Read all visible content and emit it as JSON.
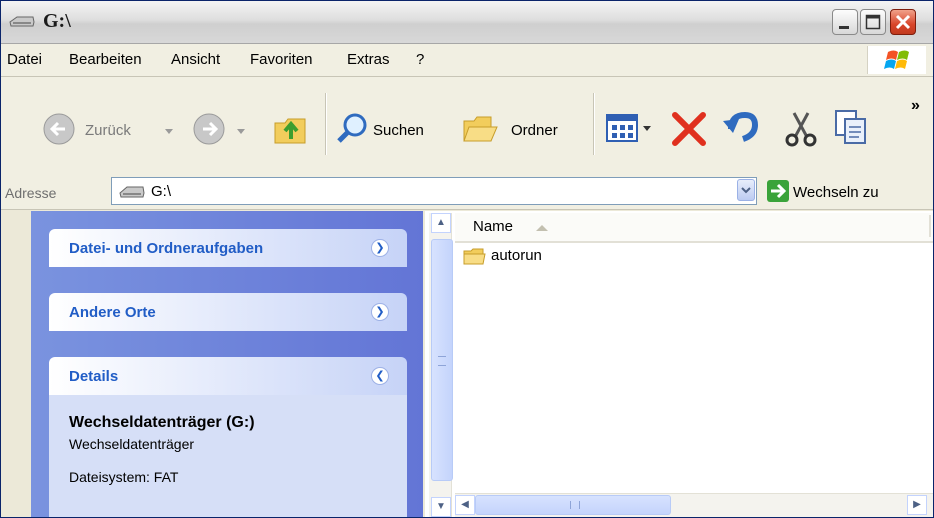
{
  "window": {
    "title": "G:\\"
  },
  "menubar": {
    "items": [
      {
        "label": "Datei"
      },
      {
        "label": "Bearbeiten"
      },
      {
        "label": "Ansicht"
      },
      {
        "label": "Favoriten"
      },
      {
        "label": "Extras"
      },
      {
        "label": "?"
      }
    ]
  },
  "toolbar": {
    "back_label": "Zurück",
    "search_label": "Suchen",
    "folders_label": "Ordner",
    "overflow": "»",
    "icons": [
      "back-icon",
      "forward-icon",
      "up-folder-icon",
      "search-icon",
      "folders-icon",
      "views-icon",
      "delete-icon",
      "undo-icon",
      "cut-icon",
      "copy-icon"
    ]
  },
  "address": {
    "label": "Adresse",
    "value": "G:\\",
    "go_label": "Wechseln zu"
  },
  "taskpane": {
    "sections": [
      {
        "title": "Datei- und Ordneraufgaben",
        "state": "collapsed"
      },
      {
        "title": "Andere Orte",
        "state": "collapsed"
      },
      {
        "title": "Details",
        "state": "expanded"
      }
    ],
    "details": {
      "name": "Wechseldatenträger (G:)",
      "type": "Wechseldatenträger",
      "filesystem": "Dateisystem: FAT"
    }
  },
  "filelist": {
    "columns": [
      {
        "label": "Name",
        "sort": "ascending"
      }
    ],
    "items": [
      {
        "name": "autorun",
        "type": "folder"
      }
    ]
  },
  "colors": {
    "taskpane_bg": "#6375d6",
    "taskpane_header_text": "#215dc6",
    "close_button": "#d8452a"
  }
}
